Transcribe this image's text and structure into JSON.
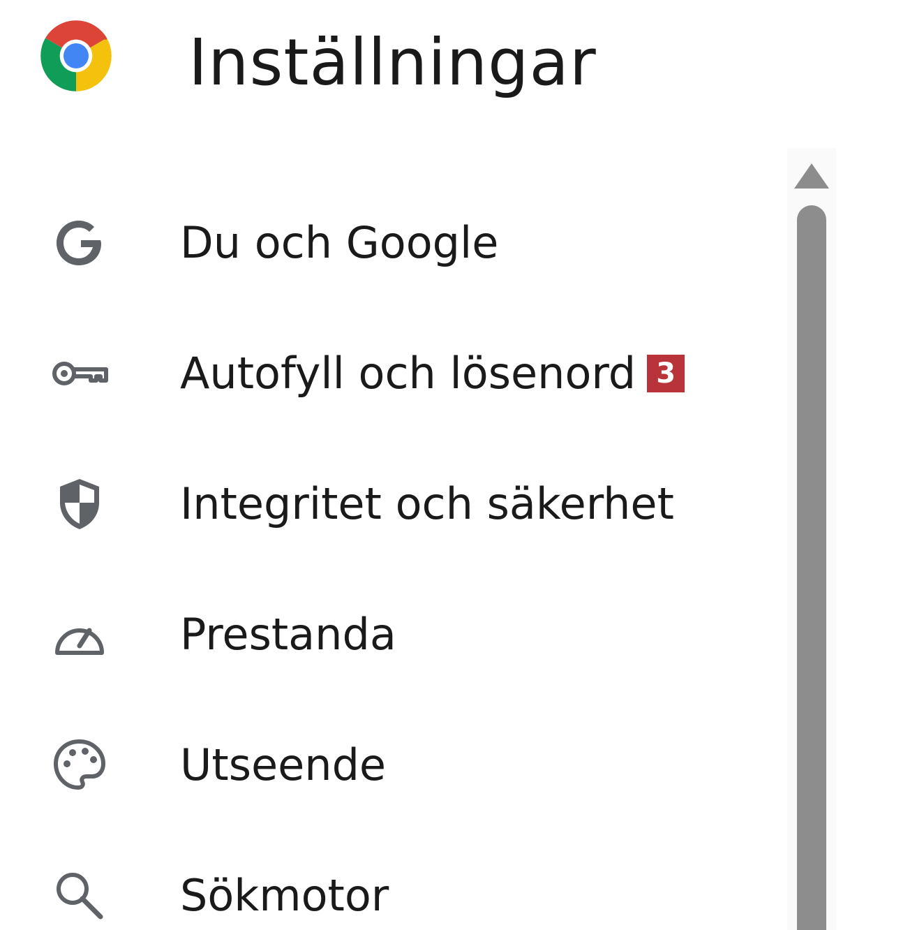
{
  "header": {
    "title": "Inställningar",
    "logo_icon": "chrome-logo-icon"
  },
  "sidebar": {
    "items": [
      {
        "label": "Du och Google",
        "icon": "google-g-icon"
      },
      {
        "label": "Autofyll och lösenord",
        "icon": "key-icon",
        "badge": "3"
      },
      {
        "label": "Integritet och säkerhet",
        "icon": "shield-icon"
      },
      {
        "label": "Prestanda",
        "icon": "speedometer-icon"
      },
      {
        "label": "Utseende",
        "icon": "palette-icon"
      },
      {
        "label": "Sökmotor",
        "icon": "search-icon"
      }
    ]
  },
  "colors": {
    "icon_gray": "#5f6368",
    "badge_red": "#b8333a",
    "scroll_thumb": "#8d8d8d",
    "chrome_red": "#db4437",
    "chrome_yellow": "#f4b400",
    "chrome_green": "#0f9d58",
    "chrome_blue": "#4285f4"
  }
}
